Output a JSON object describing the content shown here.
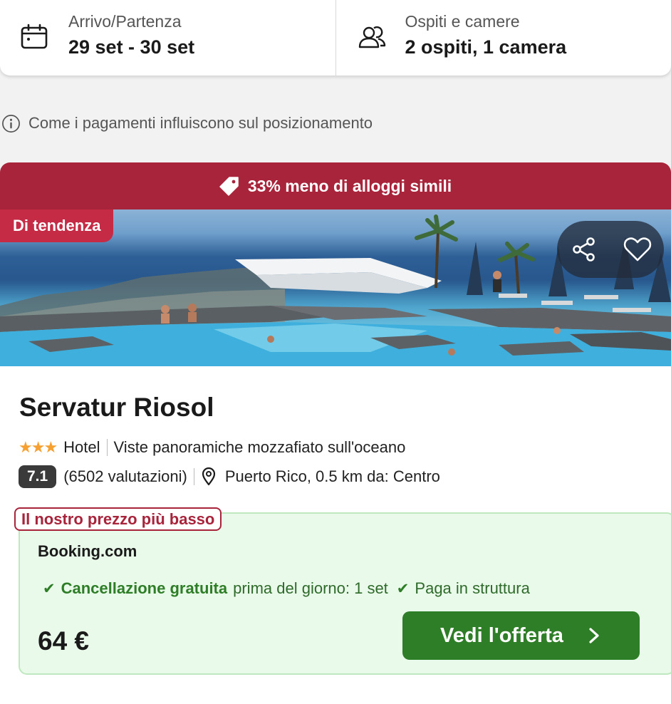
{
  "search": {
    "dates": {
      "label": "Arrivo/Partenza",
      "value": "29 set - 30 set"
    },
    "guests": {
      "label": "Ospiti e camere",
      "value": "2 ospiti, 1 camera"
    }
  },
  "disclaimer": "Come i pagamenti influiscono sul posizionamento",
  "hotel": {
    "deal_banner": "33% meno di alloggi simili",
    "trend_badge": "Di tendenza",
    "name": "Servatur Riosol",
    "stars_display": "★★★",
    "type": "Hotel",
    "highlight": "Viste panoramiche mozzafiato sull'oceano",
    "score": "7.1",
    "reviews": "(6502 valutazioni)",
    "location": "Puerto Rico, 0.5 km da: Centro"
  },
  "offer": {
    "label": "Il nostro prezzo più basso",
    "provider": "Booking.com",
    "perk1_strong": "Cancellazione gratuita",
    "perk1_rest": "prima del giorno: 1 set",
    "perk2": "Paga in struttura",
    "price": "64 €",
    "cta": "Vedi l'offerta"
  },
  "colors": {
    "deal_red": "#a8243b",
    "trend_red": "#c62b45",
    "green": "#2e7d27",
    "offer_bg": "#eafaea",
    "star": "#f5a031"
  },
  "icons": [
    "calendar-icon",
    "people-icon",
    "info-icon",
    "price-tag-icon",
    "share-icon",
    "heart-icon",
    "location-pin-icon",
    "check-icon",
    "chevron-right-icon"
  ]
}
